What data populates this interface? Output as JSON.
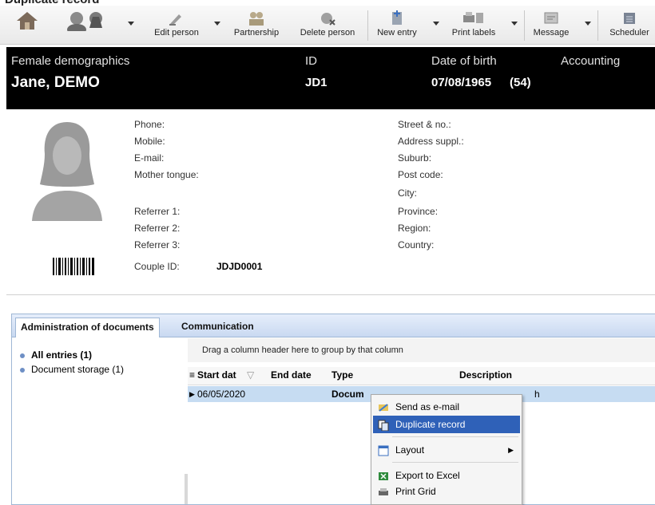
{
  "window": {
    "cut_title": "Duplicate record"
  },
  "toolbar": {
    "buttons": [
      {
        "label": ""
      },
      {
        "label": ""
      },
      {
        "label": "Edit person"
      },
      {
        "label": "Partnership"
      },
      {
        "label": "Delete person"
      },
      {
        "label": "New entry"
      },
      {
        "label": "Print labels"
      },
      {
        "label": "Message"
      },
      {
        "label": "Scheduler"
      }
    ]
  },
  "header": {
    "name_label": "Female demographics",
    "name_value": "Jane, DEMO",
    "id_label": "ID",
    "id_value": "JD1",
    "dob_label": "Date of birth",
    "dob_value": "07/08/1965",
    "age": "(54)",
    "accounting_label": "Accounting"
  },
  "details": {
    "left_fields": [
      "Phone:",
      "Mobile:",
      "E-mail:",
      "Mother tongue:"
    ],
    "referrers": [
      "Referrer 1:",
      "Referrer 2:",
      "Referrer 3:"
    ],
    "couple_label": "Couple ID:",
    "couple_value": "JDJD0001",
    "address_fields": [
      "Street & no.:",
      "Address suppl.:",
      "Suburb:",
      "Post code:",
      "City:",
      "Province:",
      "Region:",
      "Country:"
    ]
  },
  "tabs": [
    "Administration of documents",
    "Communication"
  ],
  "tree": [
    {
      "label": "All entries (1)"
    },
    {
      "label": "Document storage (1)"
    }
  ],
  "grid": {
    "group_hint": "Drag a column header here to group by that column",
    "columns": [
      "Start dat",
      "End date",
      "Type",
      "Description"
    ],
    "rows": [
      {
        "start": "06/05/2020",
        "end": "",
        "type": "Docum",
        "description": "h"
      }
    ]
  },
  "context_menu": {
    "items": [
      "Send as e-mail",
      "Duplicate record",
      "Layout",
      "Export to Excel",
      "Print Grid"
    ],
    "highlighted": "Duplicate record"
  },
  "colors": {
    "header_bg": "#000000",
    "highlight": "#2f61b8",
    "row_selected": "#c6dcf2"
  }
}
